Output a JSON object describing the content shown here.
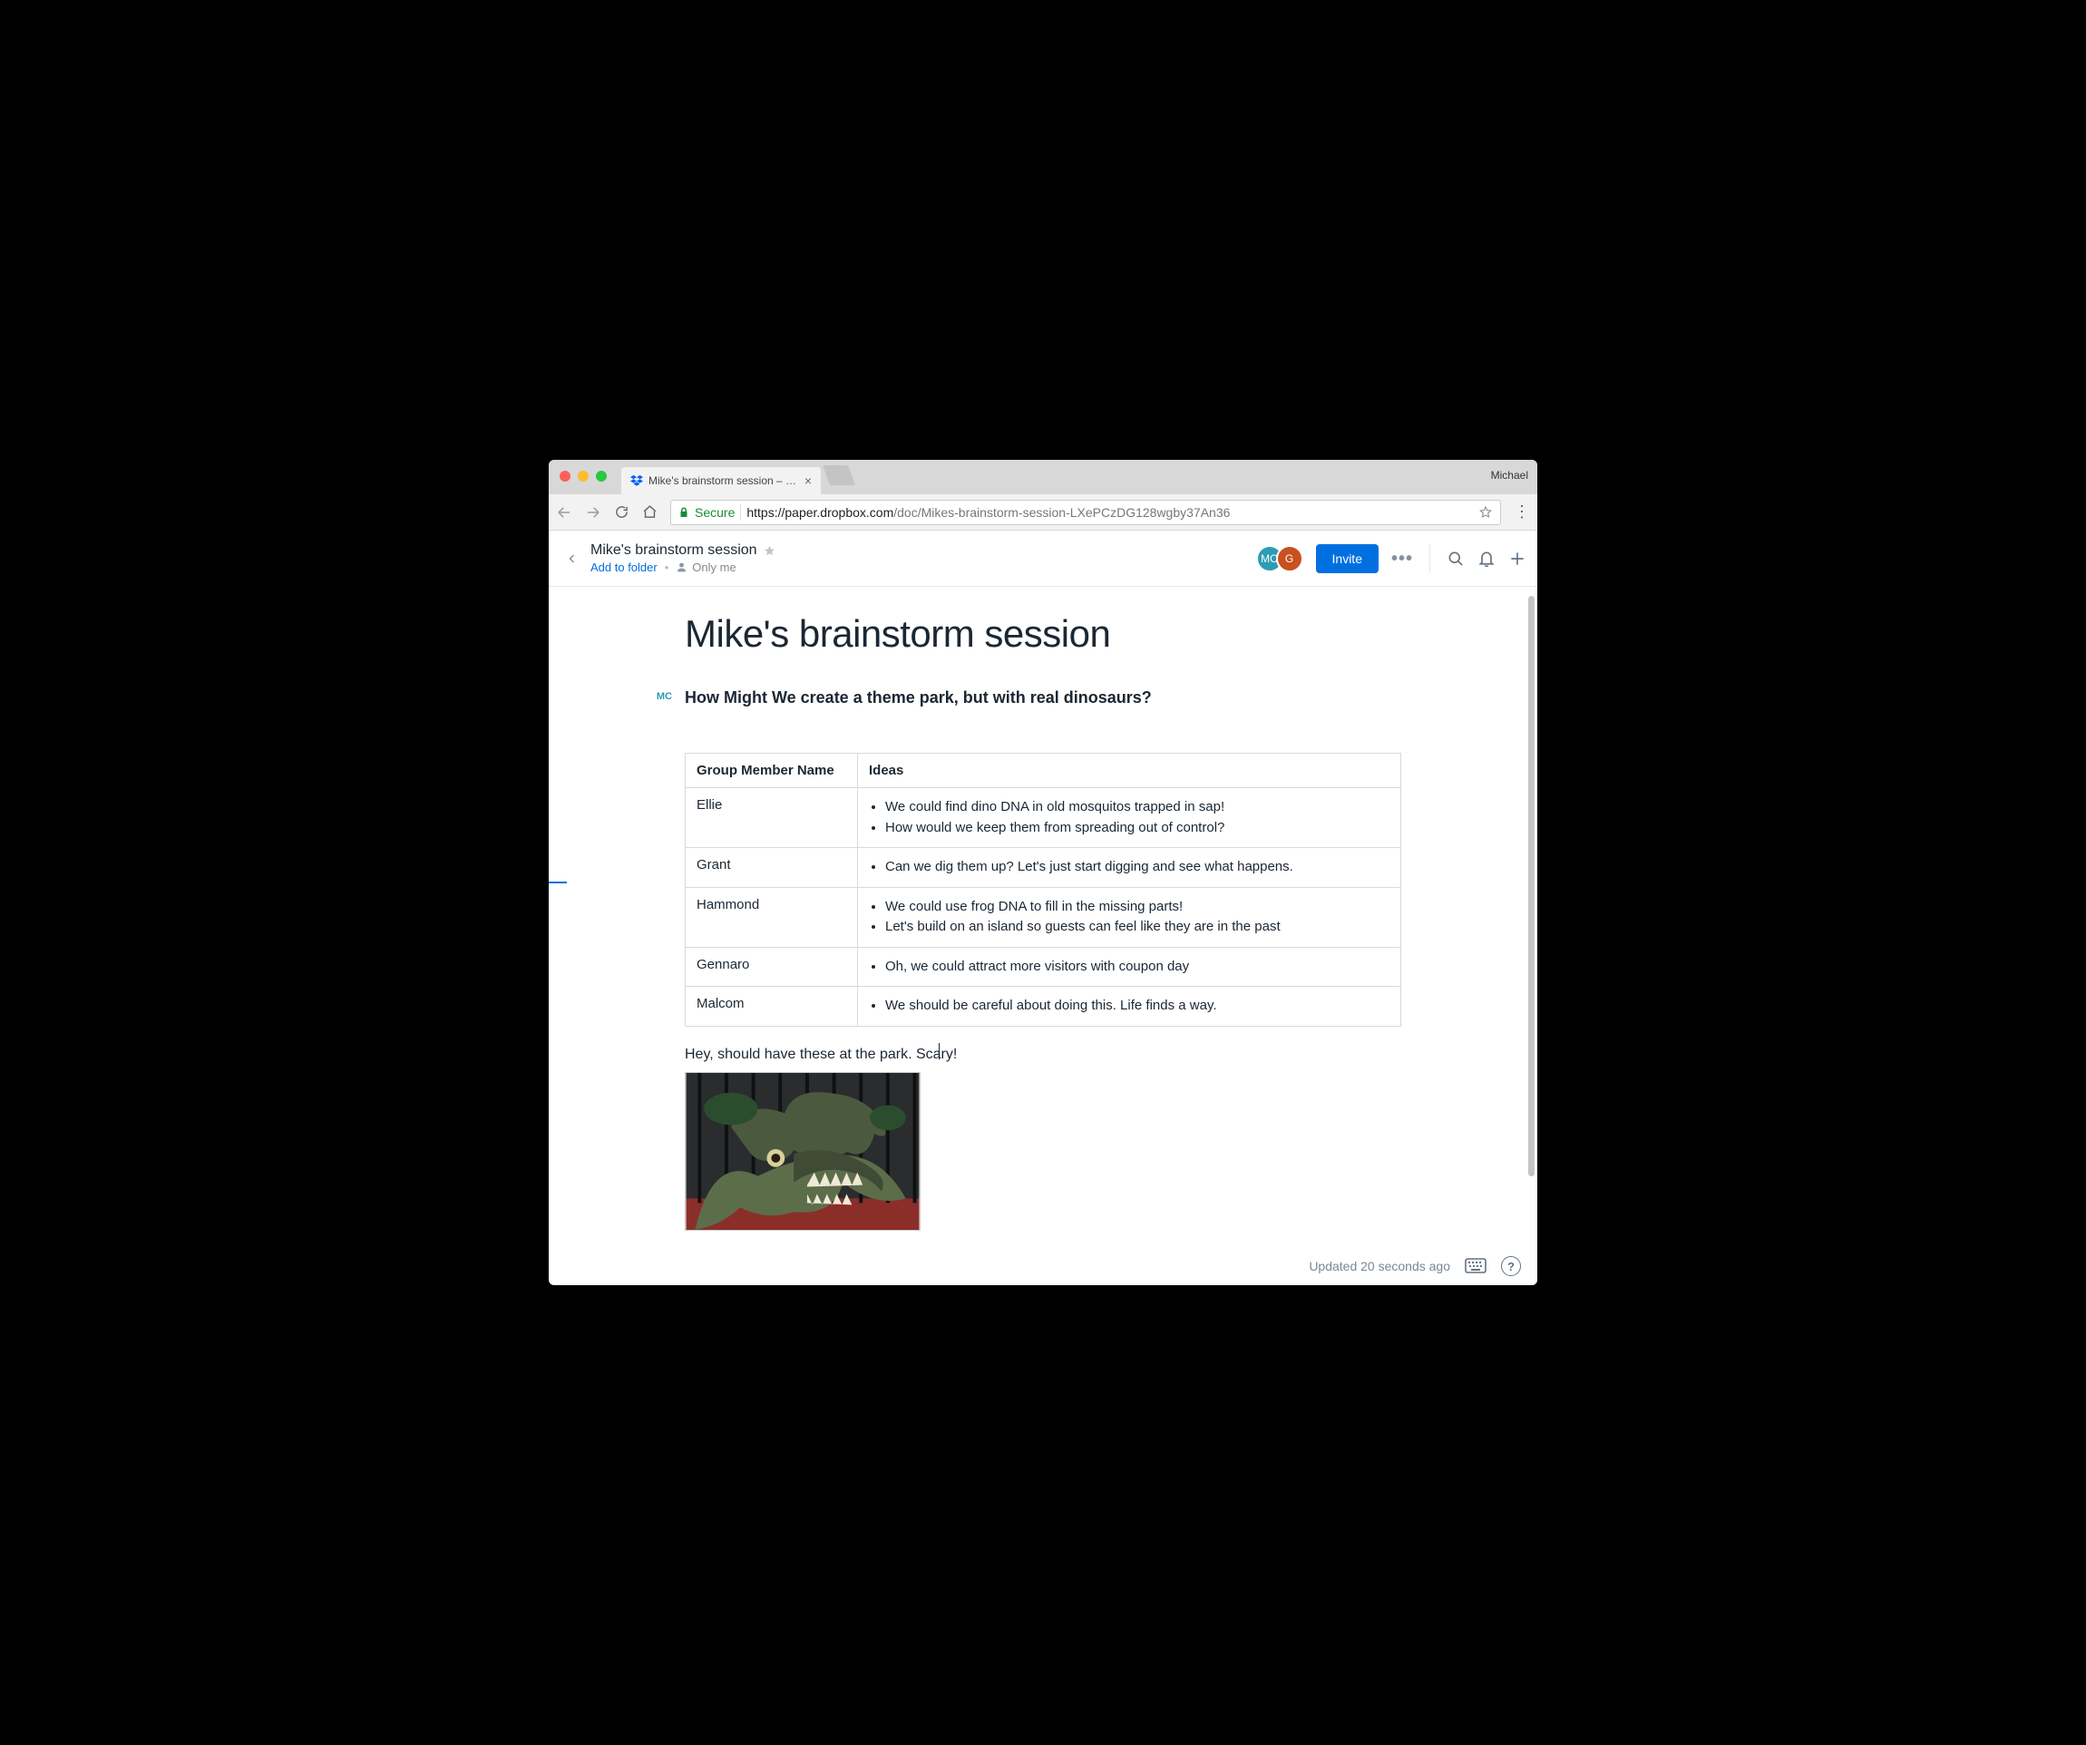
{
  "chrome": {
    "profile_name": "Michael",
    "tab": {
      "title": "Mike's brainstorm session – Dr…",
      "favicon": "dropbox-icon"
    },
    "omnibox": {
      "secure_label": "Secure",
      "host": "https://paper.dropbox.com",
      "path": "/doc/Mikes-brainstorm-session-LXePCzDG128wgby37An36"
    }
  },
  "header": {
    "doc_title": "Mike's brainstorm session",
    "add_folder_label": "Add to folder",
    "permission_label": "Only me",
    "avatars": [
      {
        "initials": "MC",
        "color": "teal"
      },
      {
        "initials": "G",
        "color": "orange"
      }
    ],
    "invite_label": "Invite"
  },
  "document": {
    "title": "Mike's brainstorm session",
    "author_badge": "MC",
    "question": "How Might We create a theme park, but with real dinosaurs?",
    "table": {
      "headers": [
        "Group Member Name",
        "Ideas"
      ],
      "rows": [
        {
          "name": "Ellie",
          "ideas": [
            "We could find dino DNA in old mosquitos trapped in sap!",
            "How would we keep them from spreading out of control?"
          ]
        },
        {
          "name": "Grant",
          "ideas": [
            "Can we dig them up? Let's just start digging and see what happens."
          ]
        },
        {
          "name": "Hammond",
          "ideas": [
            "We could use frog DNA to fill in the missing parts!",
            "Let's build on an island so guests can feel like they are in the past"
          ]
        },
        {
          "name": "Gennaro",
          "ideas": [
            "Oh, we could attract more visitors with coupon day"
          ]
        },
        {
          "name": "Malcom",
          "ideas": [
            "We should be careful about doing this. Life finds a way."
          ]
        }
      ]
    },
    "body_text": "Hey, should have these at the park. Scary!",
    "image_alt": "dinosaur photo"
  },
  "footer": {
    "updated_label": "Updated 20 seconds ago"
  }
}
